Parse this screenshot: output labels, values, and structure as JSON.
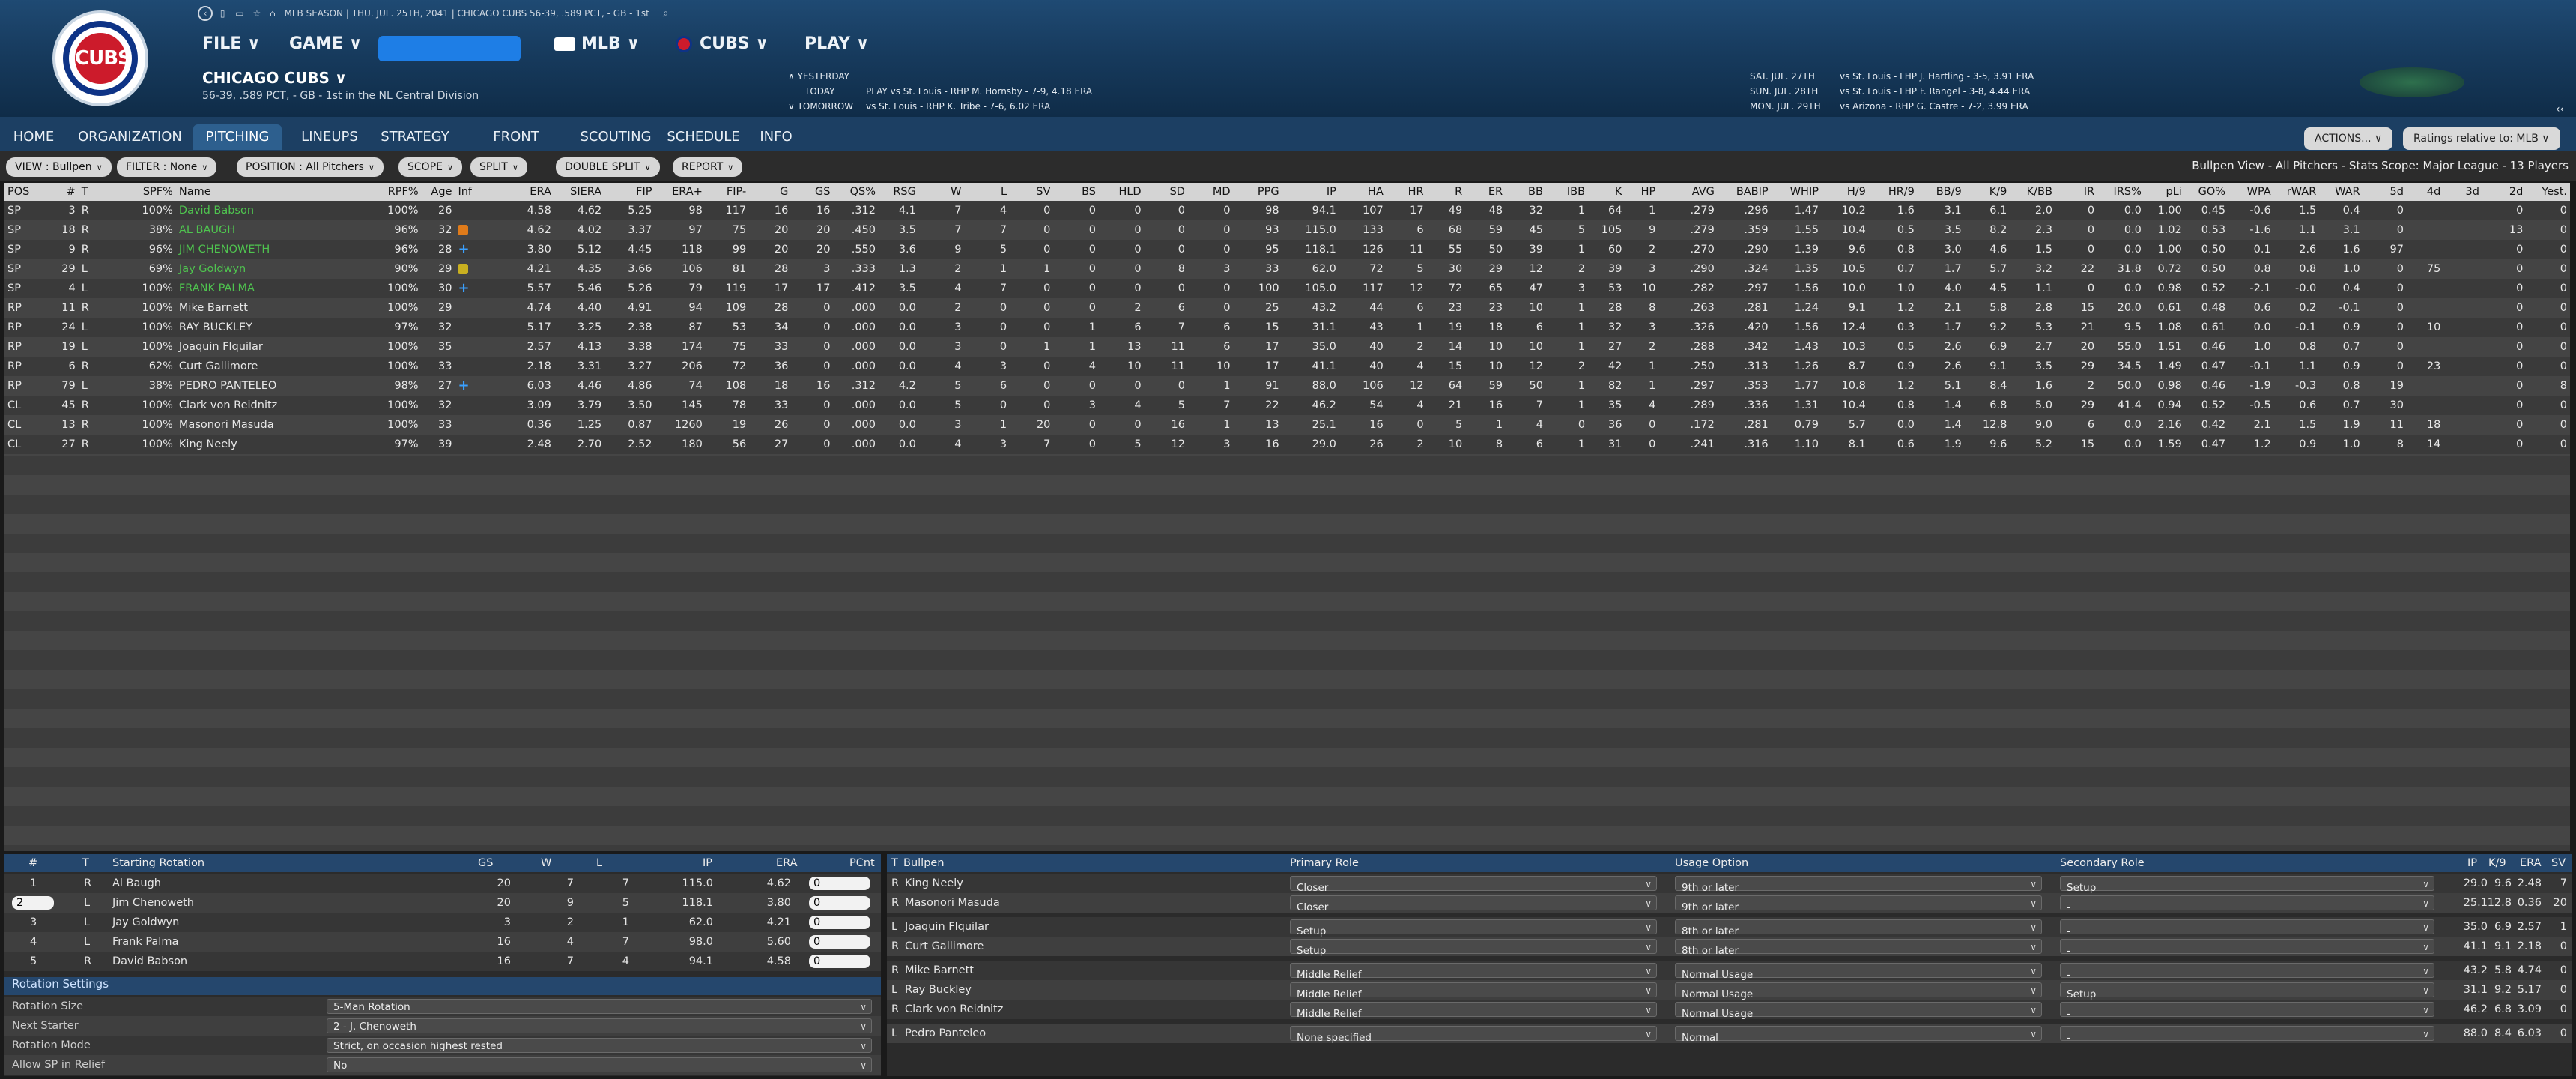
{
  "header": {
    "logo_text": "CUBS",
    "topline": "MLB SEASON  |  THU. JUL. 25TH, 2041  |  CHICAGO CUBS  56-39, .589 PCT, - GB - 1st",
    "menu": [
      "FILE ∨",
      "GAME ∨",
      "MLB ∨",
      "CUBS ∨",
      "PLAY ∨"
    ],
    "team_name": "CHICAGO CUBS ∨",
    "team_record": "56-39, .589 PCT, - GB - 1st in the NL Central Division",
    "schedule_left": [
      {
        "label": "∧  YESTERDAY",
        "text": ""
      },
      {
        "label": "TODAY",
        "text": "PLAY vs St. Louis - RHP M. Hornsby - 7-9, 4.18 ERA"
      },
      {
        "label": "∨  TOMORROW",
        "text": "vs St. Louis - RHP K. Tribe - 7-6, 6.02 ERA"
      }
    ],
    "schedule_right": [
      {
        "label": "SAT. JUL. 27TH",
        "text": "vs St. Louis - LHP J. Hartling - 3-5, 3.91 ERA"
      },
      {
        "label": "SUN. JUL. 28TH",
        "text": "vs St. Louis - LHP F. Rangel - 3-8, 4.44 ERA"
      },
      {
        "label": "MON. JUL. 29TH",
        "text": "vs Arizona - RHP G. Castre - 7-2, 3.99 ERA"
      }
    ],
    "collapse": "‹‹"
  },
  "tabs": [
    "HOME",
    "ORGANIZATION",
    "PITCHING",
    "LINEUPS",
    "STRATEGY",
    "FRONT OFFICE",
    "SCOUTING",
    "SCHEDULE",
    "INFO"
  ],
  "active_tab": "PITCHING",
  "actions_btn": "ACTIONS... ∨",
  "ratings_btn": "Ratings relative to: MLB ∨",
  "filters": [
    "VIEW : Bullpen",
    "FILTER : None",
    "POSITION : All Pitchers",
    "SCOPE",
    "SPLIT",
    "DOUBLE SPLIT",
    "REPORT"
  ],
  "view_info": "Bullpen View - All Pitchers - Stats Scope: Major League - 13 Players",
  "table": {
    "columns": [
      "POS",
      "#",
      "T",
      "SPF%",
      "Name",
      "RPF%",
      "Age",
      "Inf",
      "ERA",
      "SIERA",
      "FIP",
      "ERA+",
      "FIP-",
      "G",
      "GS",
      "QS%",
      "RSG",
      "W",
      "L",
      "SV",
      "BS",
      "HLD",
      "SD",
      "MD",
      "PPG",
      "IP",
      "HA",
      "HR",
      "R",
      "ER",
      "BB",
      "IBB",
      "K",
      "HP",
      "AVG",
      "BABIP",
      "WHIP",
      "H/9",
      "HR/9",
      "BB/9",
      "K/9",
      "K/BB",
      "IR",
      "IRS%",
      "pLi",
      "GO%",
      "WPA",
      "rWAR",
      "WAR",
      "5d",
      "4d",
      "3d",
      "2d",
      "Yest."
    ],
    "rows": [
      {
        "cells": [
          "SP",
          "3",
          "R",
          "100%",
          "David Babson",
          "100%",
          "26",
          "",
          "4.58",
          "4.62",
          "5.25",
          "98",
          "117",
          "16",
          "16",
          ".312",
          "4.1",
          "7",
          "4",
          "0",
          "0",
          "0",
          "0",
          "0",
          "98",
          "94.1",
          "107",
          "17",
          "49",
          "48",
          "32",
          "1",
          "64",
          "1",
          ".279",
          ".296",
          "1.47",
          "10.2",
          "1.6",
          "3.1",
          "6.1",
          "2.0",
          "0",
          "0.0",
          "1.00",
          "0.45",
          "-0.6",
          "1.5",
          "0.4",
          "0",
          "",
          "",
          "0",
          "0"
        ],
        "green": true,
        "inf": ""
      },
      {
        "cells": [
          "SP",
          "18",
          "R",
          "38%",
          "AL BAUGH",
          "96%",
          "32",
          "",
          "4.62",
          "4.02",
          "3.37",
          "97",
          "75",
          "20",
          "20",
          ".450",
          "3.5",
          "7",
          "7",
          "0",
          "0",
          "0",
          "0",
          "0",
          "93",
          "115.0",
          "133",
          "6",
          "68",
          "59",
          "45",
          "5",
          "105",
          "9",
          ".279",
          ".359",
          "1.55",
          "10.4",
          "0.5",
          "3.5",
          "8.2",
          "2.3",
          "0",
          "0.0",
          "1.02",
          "0.53",
          "-1.6",
          "1.1",
          "3.1",
          "0",
          "",
          "",
          "13",
          "0"
        ],
        "green": true,
        "inf": "up"
      },
      {
        "cells": [
          "SP",
          "9",
          "R",
          "96%",
          "JIM CHENOWETH",
          "96%",
          "28",
          "",
          "3.80",
          "5.12",
          "4.45",
          "118",
          "99",
          "20",
          "20",
          ".550",
          "3.6",
          "9",
          "5",
          "0",
          "0",
          "0",
          "0",
          "0",
          "95",
          "118.1",
          "126",
          "11",
          "55",
          "50",
          "39",
          "1",
          "60",
          "2",
          ".270",
          ".290",
          "1.39",
          "9.6",
          "0.8",
          "3.0",
          "4.6",
          "1.5",
          "0",
          "0.0",
          "1.00",
          "0.50",
          "0.1",
          "2.6",
          "1.6",
          "97",
          "",
          "",
          "0",
          "0"
        ],
        "green": true,
        "inf": "plus"
      },
      {
        "cells": [
          "SP",
          "29",
          "L",
          "69%",
          "Jay Goldwyn",
          "90%",
          "29",
          "",
          "4.21",
          "4.35",
          "3.66",
          "106",
          "81",
          "28",
          "3",
          ".333",
          "1.3",
          "2",
          "1",
          "1",
          "0",
          "0",
          "8",
          "3",
          "33",
          "62.0",
          "72",
          "5",
          "30",
          "29",
          "12",
          "2",
          "39",
          "3",
          ".290",
          ".324",
          "1.35",
          "10.5",
          "0.7",
          "1.7",
          "5.7",
          "3.2",
          "22",
          "31.8",
          "0.72",
          "0.50",
          "0.8",
          "0.8",
          "1.0",
          "0",
          "75",
          "",
          "0",
          "0"
        ],
        "green": true,
        "inf": "dn"
      },
      {
        "cells": [
          "SP",
          "4",
          "L",
          "100%",
          "FRANK PALMA",
          "100%",
          "30",
          "",
          "5.57",
          "5.46",
          "5.26",
          "79",
          "119",
          "17",
          "17",
          ".412",
          "3.5",
          "4",
          "7",
          "0",
          "0",
          "0",
          "0",
          "0",
          "100",
          "105.0",
          "117",
          "12",
          "72",
          "65",
          "47",
          "3",
          "53",
          "10",
          ".282",
          ".297",
          "1.56",
          "10.0",
          "1.0",
          "4.0",
          "4.5",
          "1.1",
          "0",
          "0.0",
          "0.98",
          "0.52",
          "-2.1",
          "-0.0",
          "0.4",
          "0",
          "",
          "",
          "0",
          "0"
        ],
        "green": true,
        "inf": "plus"
      },
      {
        "cells": [
          "RP",
          "11",
          "R",
          "100%",
          "Mike Barnett",
          "100%",
          "29",
          "",
          "4.74",
          "4.40",
          "4.91",
          "94",
          "109",
          "28",
          "0",
          ".000",
          "0.0",
          "2",
          "0",
          "0",
          "0",
          "2",
          "6",
          "0",
          "25",
          "43.2",
          "44",
          "6",
          "23",
          "23",
          "10",
          "1",
          "28",
          "8",
          ".263",
          ".281",
          "1.24",
          "9.1",
          "1.2",
          "2.1",
          "5.8",
          "2.8",
          "15",
          "20.0",
          "0.61",
          "0.48",
          "0.6",
          "0.2",
          "-0.1",
          "0",
          "",
          "",
          "0",
          "0"
        ],
        "green": false,
        "inf": ""
      },
      {
        "cells": [
          "RP",
          "24",
          "L",
          "100%",
          "RAY BUCKLEY",
          "97%",
          "32",
          "",
          "5.17",
          "3.25",
          "2.38",
          "87",
          "53",
          "34",
          "0",
          ".000",
          "0.0",
          "3",
          "0",
          "0",
          "1",
          "6",
          "7",
          "6",
          "15",
          "31.1",
          "43",
          "1",
          "19",
          "18",
          "6",
          "1",
          "32",
          "3",
          ".326",
          ".420",
          "1.56",
          "12.4",
          "0.3",
          "1.7",
          "9.2",
          "5.3",
          "21",
          "9.5",
          "1.08",
          "0.61",
          "0.0",
          "-0.1",
          "0.9",
          "0",
          "10",
          "",
          "0",
          "0"
        ],
        "green": false,
        "inf": ""
      },
      {
        "cells": [
          "RP",
          "19",
          "L",
          "100%",
          "Joaquin Flquilar",
          "100%",
          "35",
          "",
          "2.57",
          "4.13",
          "3.38",
          "174",
          "75",
          "33",
          "0",
          ".000",
          "0.0",
          "3",
          "0",
          "1",
          "1",
          "13",
          "11",
          "6",
          "17",
          "35.0",
          "40",
          "2",
          "14",
          "10",
          "10",
          "1",
          "27",
          "2",
          ".288",
          ".342",
          "1.43",
          "10.3",
          "0.5",
          "2.6",
          "6.9",
          "2.7",
          "20",
          "55.0",
          "1.51",
          "0.46",
          "1.0",
          "0.8",
          "0.7",
          "0",
          "",
          "",
          "0",
          "0"
        ],
        "green": false,
        "inf": ""
      },
      {
        "cells": [
          "RP",
          "6",
          "R",
          "62%",
          "Curt Gallimore",
          "100%",
          "33",
          "",
          "2.18",
          "3.31",
          "3.27",
          "206",
          "72",
          "36",
          "0",
          ".000",
          "0.0",
          "4",
          "3",
          "0",
          "4",
          "10",
          "11",
          "10",
          "17",
          "41.1",
          "40",
          "4",
          "15",
          "10",
          "12",
          "2",
          "42",
          "1",
          ".250",
          ".313",
          "1.26",
          "8.7",
          "0.9",
          "2.6",
          "9.1",
          "3.5",
          "29",
          "34.5",
          "1.49",
          "0.47",
          "-0.1",
          "1.1",
          "0.9",
          "0",
          "23",
          "",
          "0",
          "0"
        ],
        "green": false,
        "inf": ""
      },
      {
        "cells": [
          "RP",
          "79",
          "L",
          "38%",
          "PEDRO PANTELEO",
          "98%",
          "27",
          "",
          "6.03",
          "4.46",
          "4.86",
          "74",
          "108",
          "18",
          "16",
          ".312",
          "4.2",
          "5",
          "6",
          "0",
          "0",
          "0",
          "0",
          "1",
          "91",
          "88.0",
          "106",
          "12",
          "64",
          "59",
          "50",
          "1",
          "82",
          "1",
          ".297",
          ".353",
          "1.77",
          "10.8",
          "1.2",
          "5.1",
          "8.4",
          "1.6",
          "2",
          "50.0",
          "0.98",
          "0.46",
          "-1.9",
          "-0.3",
          "0.8",
          "19",
          "",
          "",
          "0",
          "8"
        ],
        "green": false,
        "inf": "plus"
      },
      {
        "cells": [
          "CL",
          "45",
          "R",
          "100%",
          "Clark von Reidnitz",
          "100%",
          "32",
          "",
          "3.09",
          "3.79",
          "3.50",
          "145",
          "78",
          "33",
          "0",
          ".000",
          "0.0",
          "5",
          "0",
          "0",
          "3",
          "4",
          "5",
          "7",
          "22",
          "46.2",
          "54",
          "4",
          "21",
          "16",
          "7",
          "1",
          "35",
          "4",
          ".289",
          ".336",
          "1.31",
          "10.4",
          "0.8",
          "1.4",
          "6.8",
          "5.0",
          "29",
          "41.4",
          "0.94",
          "0.52",
          "-0.5",
          "0.6",
          "0.7",
          "30",
          "",
          "",
          "0",
          "0"
        ],
        "green": false,
        "inf": ""
      },
      {
        "cells": [
          "CL",
          "13",
          "R",
          "100%",
          "Masonori Masuda",
          "100%",
          "33",
          "",
          "0.36",
          "1.25",
          "0.87",
          "1260",
          "19",
          "26",
          "0",
          ".000",
          "0.0",
          "3",
          "1",
          "20",
          "0",
          "0",
          "16",
          "1",
          "13",
          "25.1",
          "16",
          "0",
          "5",
          "1",
          "4",
          "0",
          "36",
          "0",
          ".172",
          ".281",
          "0.79",
          "5.7",
          "0.0",
          "1.4",
          "12.8",
          "9.0",
          "6",
          "0.0",
          "2.16",
          "0.42",
          "2.1",
          "1.5",
          "1.9",
          "11",
          "18",
          "",
          "0",
          "0"
        ],
        "green": false,
        "inf": ""
      },
      {
        "cells": [
          "CL",
          "27",
          "R",
          "100%",
          "King Neely",
          "97%",
          "39",
          "",
          "2.48",
          "2.70",
          "2.52",
          "180",
          "56",
          "27",
          "0",
          ".000",
          "0.0",
          "4",
          "3",
          "7",
          "0",
          "5",
          "12",
          "3",
          "16",
          "29.0",
          "26",
          "2",
          "10",
          "8",
          "6",
          "1",
          "31",
          "0",
          ".241",
          ".316",
          "1.10",
          "8.1",
          "0.6",
          "1.9",
          "9.6",
          "5.2",
          "15",
          "0.0",
          "1.59",
          "0.47",
          "1.2",
          "0.9",
          "1.0",
          "8",
          "14",
          "",
          "0",
          "0"
        ],
        "green": false,
        "inf": ""
      }
    ]
  },
  "rotation": {
    "columns": [
      "#",
      "T",
      "Starting Rotation",
      "GS",
      "W",
      "L",
      "IP",
      "ERA",
      "PCnt"
    ],
    "rows": [
      [
        "1",
        "R",
        "Al Baugh",
        "20",
        "7",
        "7",
        "115.0",
        "4.62",
        "0"
      ],
      [
        "2",
        "L",
        "Jim Chenoweth",
        "20",
        "9",
        "5",
        "118.1",
        "3.80",
        "0"
      ],
      [
        "3",
        "L",
        "Jay Goldwyn",
        "3",
        "2",
        "1",
        "62.0",
        "4.21",
        "0"
      ],
      [
        "4",
        "L",
        "Frank Palma",
        "16",
        "4",
        "7",
        "98.0",
        "5.60",
        "0"
      ],
      [
        "5",
        "R",
        "David Babson",
        "16",
        "7",
        "4",
        "94.1",
        "4.58",
        "0"
      ]
    ],
    "settings_title": "Rotation Settings",
    "settings": [
      {
        "label": "Rotation Size",
        "value": "5-Man Rotation"
      },
      {
        "label": "Next Starter",
        "value": "2 - J. Chenoweth"
      },
      {
        "label": "Rotation Mode",
        "value": "Strict, on occasion highest rested"
      },
      {
        "label": "Allow SP in Relief",
        "value": "No"
      }
    ]
  },
  "bullpen": {
    "columns": [
      "T",
      "Bullpen",
      "Primary Role",
      "Usage Option",
      "Secondary Role",
      "IP",
      "K/9",
      "ERA",
      "SV"
    ],
    "rows": [
      {
        "t": "R",
        "name": "King Neely",
        "role": "Closer",
        "usage": "9th or later",
        "sec": "Setup",
        "ip": "29.0",
        "k9": "9.6",
        "era": "2.48",
        "sv": "7"
      },
      {
        "t": "R",
        "name": "Masonori Masuda",
        "role": "Closer",
        "usage": "9th or later",
        "sec": "-",
        "ip": "25.1",
        "k9": "12.8",
        "era": "0.36",
        "sv": "20"
      },
      {
        "t": "L",
        "name": "Joaquin Flquilar",
        "role": "Setup",
        "usage": "8th or later",
        "sec": "-",
        "ip": "35.0",
        "k9": "6.9",
        "era": "2.57",
        "sv": "1"
      },
      {
        "t": "R",
        "name": "Curt Gallimore",
        "role": "Setup",
        "usage": "8th or later",
        "sec": "-",
        "ip": "41.1",
        "k9": "9.1",
        "era": "2.18",
        "sv": "0"
      },
      {
        "t": "R",
        "name": "Mike Barnett",
        "role": "Middle Relief",
        "usage": "Normal Usage",
        "sec": "-",
        "ip": "43.2",
        "k9": "5.8",
        "era": "4.74",
        "sv": "0"
      },
      {
        "t": "L",
        "name": "Ray Buckley",
        "role": "Middle Relief",
        "usage": "Normal Usage",
        "sec": "Setup",
        "ip": "31.1",
        "k9": "9.2",
        "era": "5.17",
        "sv": "0"
      },
      {
        "t": "R",
        "name": "Clark von Reidnitz",
        "role": "Middle Relief",
        "usage": "Normal Usage",
        "sec": "-",
        "ip": "46.2",
        "k9": "6.8",
        "era": "3.09",
        "sv": "0"
      },
      {
        "t": "L",
        "name": "Pedro Panteleo",
        "role": "None specified",
        "usage": "Normal",
        "sec": "-",
        "ip": "88.0",
        "k9": "8.4",
        "era": "6.03",
        "sv": "0"
      }
    ]
  },
  "colors": {
    "accent": "#1f4a73",
    "green_name": "#4fc44f",
    "cubs_red": "#cc1b2b",
    "cubs_blue": "#0e3386"
  }
}
